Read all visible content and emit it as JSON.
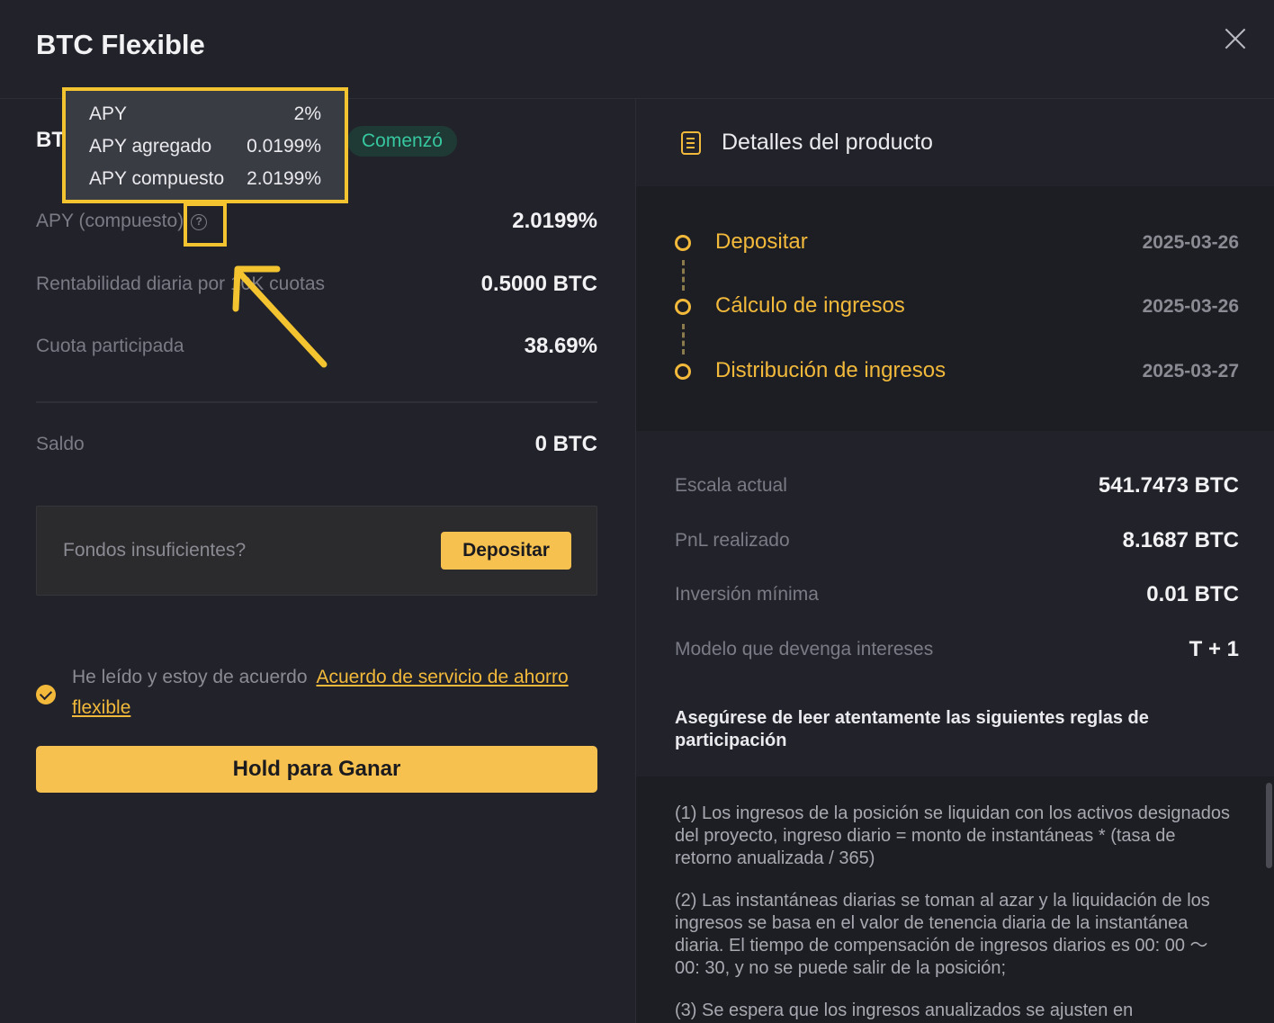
{
  "window": {
    "title": "BTC Flexible"
  },
  "left": {
    "product_name": "BTC",
    "status": "Comenzó",
    "rows": [
      {
        "label": "APY (compuesto)",
        "value": "2.0199%"
      },
      {
        "label": "Rentabilidad diaria por 10K cuotas",
        "value": "0.5000 BTC"
      },
      {
        "label": "Cuota participada",
        "value": "38.69%"
      },
      {
        "label": "Saldo",
        "value": "0 BTC"
      }
    ],
    "fund_message": "Fondos insuficientes?",
    "deposit_label": "Depositar",
    "agree_text": "He leído y estoy de acuerdo",
    "agree_link": "Acuerdo de servicio de ahorro flexible",
    "hold_label": "Hold para Ganar"
  },
  "tooltip": {
    "rows": [
      {
        "key": "APY",
        "value": "2%"
      },
      {
        "key": "APY agregado",
        "value": "0.0199%"
      },
      {
        "key": "APY compuesto",
        "value": "2.0199%"
      }
    ]
  },
  "right": {
    "section_title": "Detalles del producto",
    "timeline": [
      {
        "label": "Depositar",
        "date": "2025-03-26"
      },
      {
        "label": "Cálculo de ingresos",
        "date": "2025-03-26"
      },
      {
        "label": "Distribución de ingresos",
        "date": "2025-03-27"
      }
    ],
    "info": [
      {
        "label": "Escala actual",
        "value": "541.7473 BTC"
      },
      {
        "label": "PnL realizado",
        "value": "8.1687 BTC"
      },
      {
        "label": "Inversión mínima",
        "value": "0.01 BTC"
      },
      {
        "label": "Modelo que devenga intereses",
        "value": "T + 1"
      }
    ],
    "rules_title": "Asegúrese de leer atentamente las siguientes reglas de participación",
    "rules": [
      "(1) Los ingresos de la posición se liquidan con los activos designados del proyecto, ingreso diario = monto de instantáneas * (tasa de retorno anualizada / 365)",
      "(2) Las instantáneas diarias se toman al azar y la liquidación de los ingresos se basa en el valor de tenencia diaria de la instantánea diaria. El tiempo de compensación de ingresos diarios es 00: 00 ～ 00: 30, y no se puede salir de la posición;",
      "(3) Se espera que los ingresos anualizados se ajusten en"
    ]
  },
  "colors": {
    "accent": "#f7c14f",
    "status": "#37c7a0",
    "highlight": "#f4c430"
  }
}
